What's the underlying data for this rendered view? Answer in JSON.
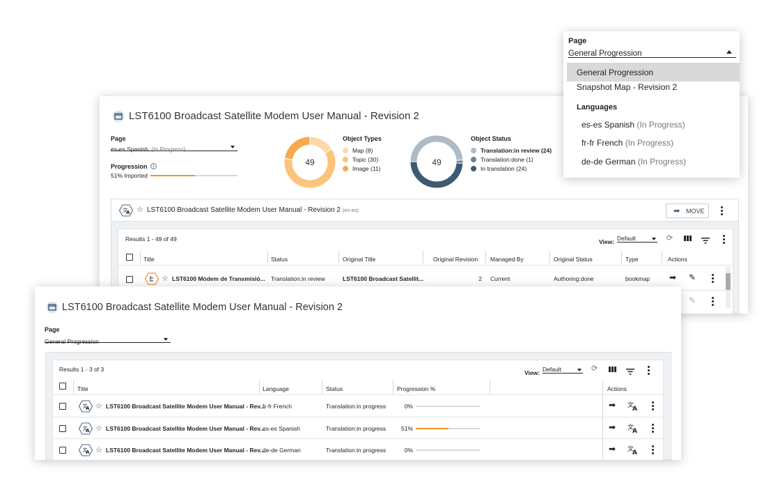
{
  "back_panel": {
    "title": "LST6100 Broadcast Satellite Modem User Manual - Revision 2",
    "page_label": "Page",
    "page_value": "es-es Spanish",
    "page_value_status": "(In Progress)",
    "progression_label": "Progression",
    "progression_text": "51% Imported",
    "progression_value": 0.51,
    "object_types": {
      "title": "Object Types",
      "total": "49",
      "legend": [
        "Map (8)",
        "Topic (30)",
        "Image (11)"
      ],
      "values": [
        8,
        30,
        11
      ],
      "colors": [
        "#fbd9a8",
        "#fbc47c",
        "#f6a94d"
      ]
    },
    "object_status": {
      "title": "Object Status",
      "total": "49",
      "legend": [
        "Translation:in review (24)",
        "Translation:done (1)",
        "In translation (24)"
      ],
      "values": [
        24,
        1,
        24
      ],
      "colors": [
        "#aebbc7",
        "#6f8497",
        "#3e5a73"
      ]
    },
    "sub": {
      "title": "LST6100 Broadcast Satellite Modem User Manual - Revision 2",
      "tag": "(es-es)",
      "move_label": "MOVE",
      "results": "Results 1 - 49 of 49",
      "view_label": "View:",
      "view_value": "Default",
      "columns": [
        "Title",
        "Status",
        "Original Title",
        "Original Revision",
        "Managed By",
        "Original Status",
        "Type",
        "Actions"
      ],
      "row": {
        "title": "LST6100 Módem de Transmisió...",
        "status": "Translation:in review",
        "original_title": "LST6100 Broadcast Satellit...",
        "revision": "2",
        "managed_by": "Current",
        "original_status": "Authoring:done",
        "type": "bookmap"
      }
    }
  },
  "dropdown": {
    "label": "Page",
    "value": "General Progression",
    "items": [
      "General Progression",
      "Snapshot Map - Revision 2"
    ],
    "section": "Languages",
    "languages": [
      {
        "name": "es-es Spanish",
        "status": "(In Progress)"
      },
      {
        "name": "fr-fr French",
        "status": "(In Progress)"
      },
      {
        "name": "de-de German",
        "status": "(In Progress)"
      }
    ]
  },
  "front_panel": {
    "title": "LST6100 Broadcast Satellite Modem User Manual - Revision 2",
    "page_label": "Page",
    "page_value": "General Progression",
    "results": "Results 1 - 3 of 3",
    "view_label": "View:",
    "view_value": "Default",
    "columns": [
      "Title",
      "Language",
      "Status",
      "Progression %",
      "Actions"
    ],
    "rows": [
      {
        "title": "LST6100 Broadcast Satellite Modem User Manual - Rev...",
        "language": "fr-fr French",
        "status": "Translation:in progress",
        "progress_text": "0%",
        "progress": 0
      },
      {
        "title": "LST6100 Broadcast Satellite Modem User Manual - Rev...",
        "language": "es-es Spanish",
        "status": "Translation:in progress",
        "progress_text": "51%",
        "progress": 0.51
      },
      {
        "title": "LST6100 Broadcast Satellite Modem User Manual - Rev...",
        "language": "de-de German",
        "status": "Translation:in progress",
        "progress_text": "0%",
        "progress": 0
      }
    ]
  }
}
